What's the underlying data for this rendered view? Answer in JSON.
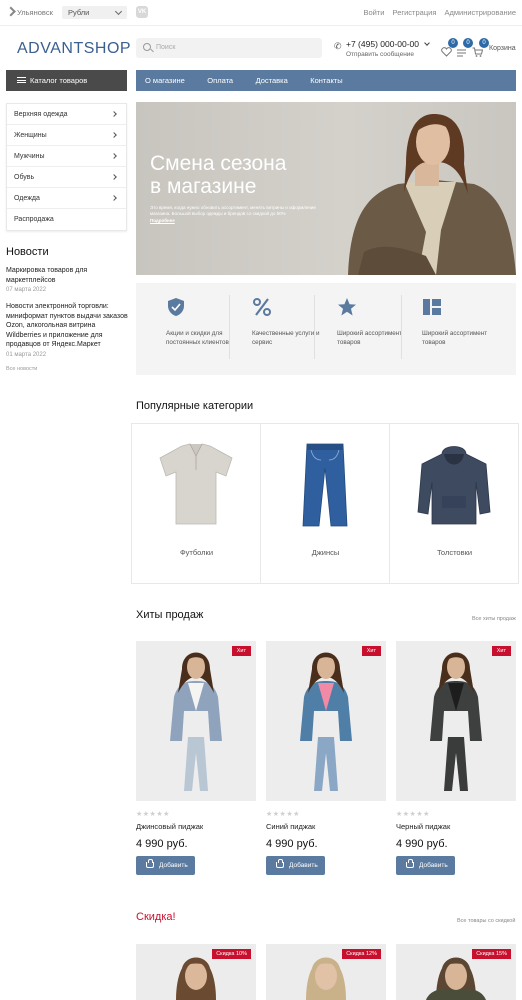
{
  "topbar": {
    "city": "Ульяновск",
    "currency": "Рубли",
    "vk": "VK",
    "login": "Войти",
    "register": "Регистрация",
    "admin": "Администрирование"
  },
  "header": {
    "logo": "ADVANTSHOP",
    "search_placeholder": "Поиск",
    "phone": "+7 (495) 000-00-00",
    "send_message": "Отправить сообщение",
    "wishlist_count": "0",
    "compare_count": "0",
    "cart_count": "0",
    "cart_label": "Корзина"
  },
  "catalog_button": "Каталог товаров",
  "nav": [
    "О магазине",
    "Оплата",
    "Доставка",
    "Контакты"
  ],
  "categories": [
    "Верхняя одежда",
    "Женщины",
    "Мужчины",
    "Обувь",
    "Одежда",
    "Распродажа"
  ],
  "news": {
    "title": "Новости",
    "items": [
      {
        "title": "Маркировка товаров для маркетплейсов",
        "date": "07 марта 2022"
      },
      {
        "title": "Новости электронной торговли: миниформат пунктов выдачи заказов Ozon, алкогольная витрина Wildberries и приложение для продавцов от Яндекс.Маркет",
        "date": "01 марта 2022"
      }
    ],
    "all": "Все новости"
  },
  "banner": {
    "title_line1": "Смена сезона",
    "title_line2": "в магазине",
    "subtitle": "Это время, когда нужно обновить ассортимент, менять витрины и оформление магазина. Большой выбор одежды и брендов со скидкой до 50%",
    "more": "Подробнее"
  },
  "features": [
    {
      "icon": "shield-check-icon",
      "text": "Акции и скидки для постоянных клиентов"
    },
    {
      "icon": "percent-icon",
      "text": "Качественные услуги и сервис"
    },
    {
      "icon": "star-icon",
      "text": "Широкий ассортимент товаров"
    },
    {
      "icon": "grid-icon",
      "text": "Широкий ассортимент товаров"
    }
  ],
  "popular": {
    "title": "Популярные категории",
    "items": [
      {
        "label": "Футболки",
        "icon": "polo-shirt-icon"
      },
      {
        "label": "Джинсы",
        "icon": "jeans-icon"
      },
      {
        "label": "Толстовки",
        "icon": "hoodie-icon"
      }
    ]
  },
  "hits": {
    "title": "Хиты продаж",
    "all": "Все хиты продаж",
    "badge": "Хит",
    "stars": "★★★★★",
    "add_label": "Добавить",
    "products": [
      {
        "name": "Джинсовый пиджак",
        "price": "4 990 руб.",
        "jacket": "#8fa3bd",
        "top": "#f4f4f2",
        "pants": "#b9c6d4"
      },
      {
        "name": "Синий пиджак",
        "price": "4 990 руб.",
        "jacket": "#4f7ea6",
        "top": "#f08aa7",
        "pants": "#8aa7c6"
      },
      {
        "name": "Черный пиджак",
        "price": "4 990 руб.",
        "jacket": "#3e403f",
        "top": "#1d1d1d",
        "pants": "#3a3c3b"
      }
    ]
  },
  "sale": {
    "title": "Скидка!",
    "all": "Все товары со скидкой",
    "items": [
      {
        "tag": "Скидка 10%"
      },
      {
        "tag": "Скидка 12%"
      },
      {
        "tag": "Скидка 15%"
      }
    ]
  },
  "colors": {
    "accent": "#5a7aa0",
    "dark": "#4a4a4a",
    "sale_red": "#c8102e",
    "badge_blue": "#2e6aa8"
  }
}
